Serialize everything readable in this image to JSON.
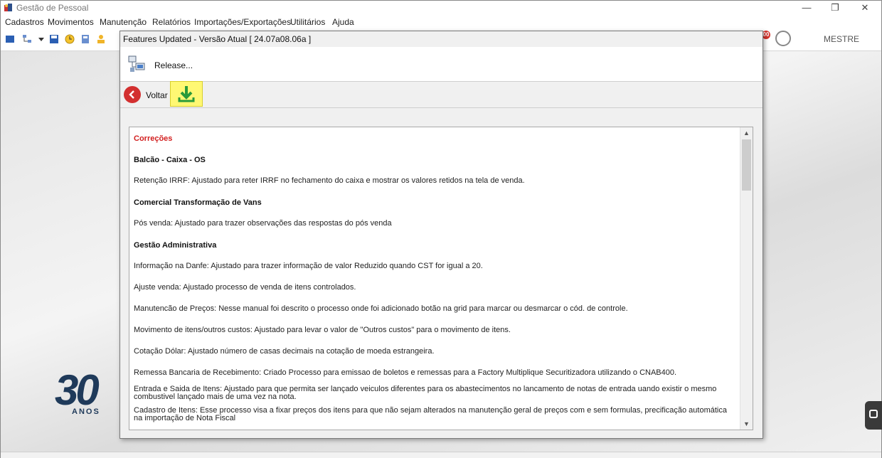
{
  "app": {
    "title": "Gestão de Pessoal"
  },
  "window_controls": {
    "minimize": "—",
    "restore": "❐",
    "close": "✕"
  },
  "menu": [
    "Cadastros",
    "Movimentos",
    "Manutenção",
    "Relatórios",
    "Importações/Exportações",
    "Utilitários",
    "Ajuda"
  ],
  "toolbar": {
    "user": "MESTRE",
    "notification_count": "00"
  },
  "dialog": {
    "title": "Features Updated - Versão Atual [ 24.07a08.06a ]",
    "release_label": "Release...",
    "back_label": "Voltar",
    "content": {
      "section_title": "Correções",
      "groups": [
        {
          "heading": "Balcão - Caixa - OS",
          "items": [
            "Retenção IRRF: Ajustado para reter IRRF no fechamento do caixa e mostrar os valores retidos na tela de venda."
          ]
        },
        {
          "heading": "Comercial Transformação de Vans",
          "items": [
            "Pós venda: Ajustado para trazer observações das respostas do pós venda"
          ]
        },
        {
          "heading": "Gestão Administrativa",
          "items": [
            "Informação na Danfe: Ajustado para trazer informação de valor Reduzido quando CST for igual a 20.",
            "Ajuste venda: Ajustado processo de venda de itens controlados.",
            "Manutencão de Preços: Nesse manual foi descrito o processo onde foi adicionado botão na grid para marcar ou desmarcar o cód. de controle.",
            "Movimento de itens/outros custos: Ajustado para levar o valor de \"Outros custos\" para o movimento de itens.",
            "Cotação Dólar: Ajustado número de casas decimais na cotação de moeda estrangeira.",
            "Remessa Bancaria de Recebimento: Criado Processo para emissao de boletos e remessas para a Factory Multiplique Securitizadora utilizando o CNAB400.",
            "Entrada e Saida de Itens: Ajustado para que permita ser lançado veiculos diferentes para os abastecimentos no lancamento de notas de entrada uando existir o mesmo combustivel lançado mais de uma vez na nota.",
            "Cadastro de Itens: Esse processo visa a fixar preços dos itens para que não sejam alterados na manutenção geral de preços com e sem formulas, precificação automática na importação de Nota Fiscal"
          ]
        }
      ]
    }
  },
  "background_logo": {
    "number": "30",
    "subtitle": "ANOS"
  },
  "colors": {
    "accent_red": "#d21f1f",
    "download_highlight": "#fff873",
    "download_arrow": "#2a9a3a",
    "logo_blue": "#1f3a5a"
  }
}
